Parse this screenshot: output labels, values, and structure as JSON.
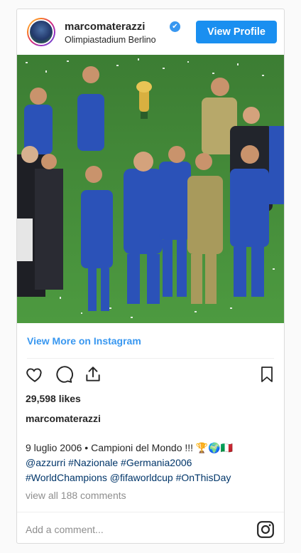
{
  "header": {
    "username": "marcomaterazzi",
    "verified_glyph": "✔",
    "location": "Olimpiastadium Berlino",
    "view_profile_label": "View Profile"
  },
  "photo": {
    "subject": "team-celebration-photo",
    "colors": {
      "pitch": "#3f8a35",
      "shirt": "#2b52b8",
      "keeper": "#a89a5c"
    }
  },
  "links": {
    "view_more": "View More on Instagram"
  },
  "actions": {
    "icons": [
      "heart-icon",
      "comment-icon",
      "share-icon",
      "bookmark-icon"
    ]
  },
  "post": {
    "likes": "29,598 likes",
    "caption_username": "marcomaterazzi",
    "caption_line1": "9 luglio 2006 • Campioni del Mondo !!! 🏆🌍🇮🇹",
    "caption_line2": "@azzurri #Nazionale #Germania2006",
    "caption_line3": "#WorldChampions @fifaworldcup #OnThisDay",
    "view_comments": "view all 188 comments"
  },
  "comment": {
    "placeholder": "Add a comment..."
  },
  "colors": {
    "accent": "#1a8ff0",
    "link": "#3897f0",
    "hashtag": "#003569",
    "muted": "#8e8e8e"
  }
}
